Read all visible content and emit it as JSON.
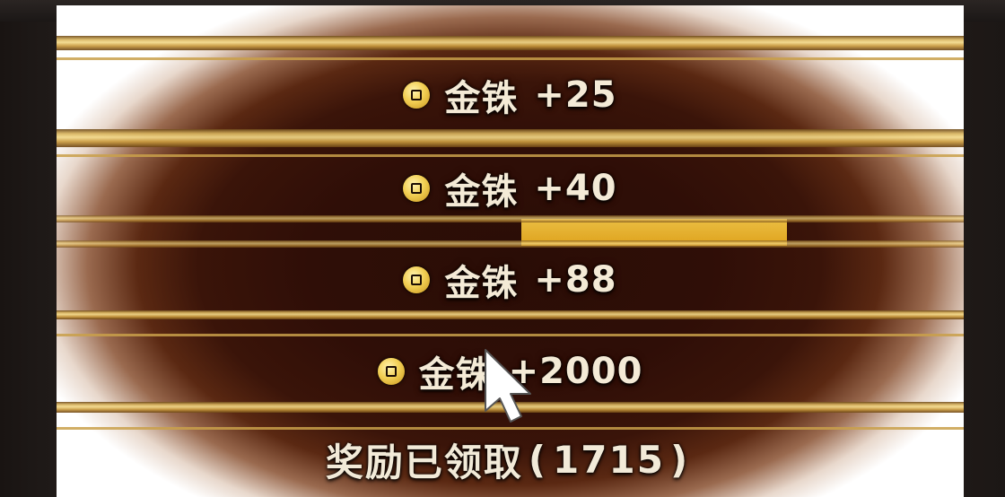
{
  "rewards": [
    {
      "label": "金铢",
      "amount": "+25",
      "icon": "gold-coin-icon"
    },
    {
      "label": "金铢",
      "amount": "+40",
      "icon": "gold-coin-icon"
    },
    {
      "label": "金铢",
      "amount": "+88",
      "icon": "gold-coin-icon"
    },
    {
      "label": "金铢",
      "amount": "+2000",
      "icon": "gold-coin-icon"
    }
  ],
  "footer": {
    "text": "奖励已领取",
    "paren_open": "(",
    "count": "1715",
    "paren_close": ")"
  },
  "colors": {
    "gold": "#f2cf54",
    "text": "#f4ead6",
    "background": "#2f0e07"
  }
}
